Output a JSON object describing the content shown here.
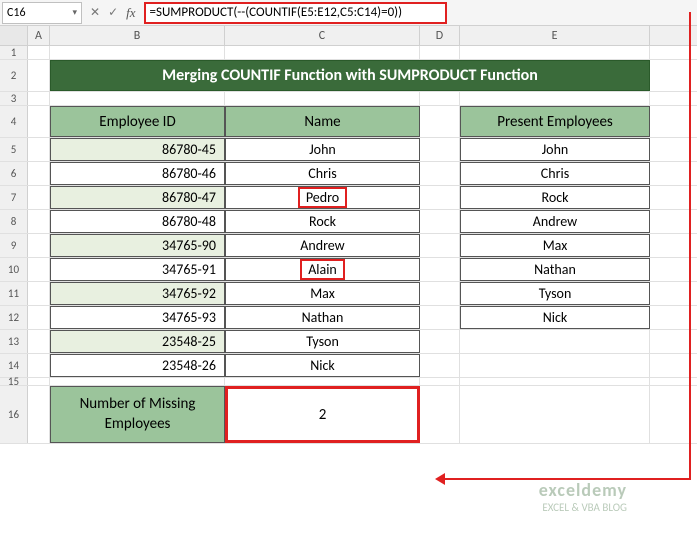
{
  "nameBox": "C16",
  "formula": "=SUMPRODUCT(--(COUNTIF(E5:E12,C5:C14)=0))",
  "colHeaders": [
    "A",
    "B",
    "C",
    "D",
    "E"
  ],
  "title": "Merging COUNTIF Function with SUMPRODUCT Function",
  "headers": {
    "id": "Employee ID",
    "name": "Name",
    "present": "Present Employees"
  },
  "rows": [
    {
      "id": "86780-45",
      "name": "John",
      "present": "John",
      "hl": false
    },
    {
      "id": "86780-46",
      "name": "Chris",
      "present": "Chris",
      "hl": false
    },
    {
      "id": "86780-47",
      "name": "Pedro",
      "present": "Rock",
      "hl": true
    },
    {
      "id": "86780-48",
      "name": "Rock",
      "present": "Andrew",
      "hl": false
    },
    {
      "id": "34765-90",
      "name": "Andrew",
      "present": "Max",
      "hl": false
    },
    {
      "id": "34765-91",
      "name": "Alain",
      "present": "Nathan",
      "hl": true
    },
    {
      "id": "34765-92",
      "name": "Max",
      "present": "Tyson",
      "hl": false
    },
    {
      "id": "34765-93",
      "name": "Nathan",
      "present": "Nick",
      "hl": false
    },
    {
      "id": "23548-25",
      "name": "Tyson",
      "present": "",
      "hl": false
    },
    {
      "id": "23548-26",
      "name": "Nick",
      "present": "",
      "hl": false
    }
  ],
  "missingLabel": "Number of Missing Employees",
  "result": "2",
  "watermark": {
    "brand": "exceldemy",
    "tag": "EXCEL & VBA BLOG"
  }
}
